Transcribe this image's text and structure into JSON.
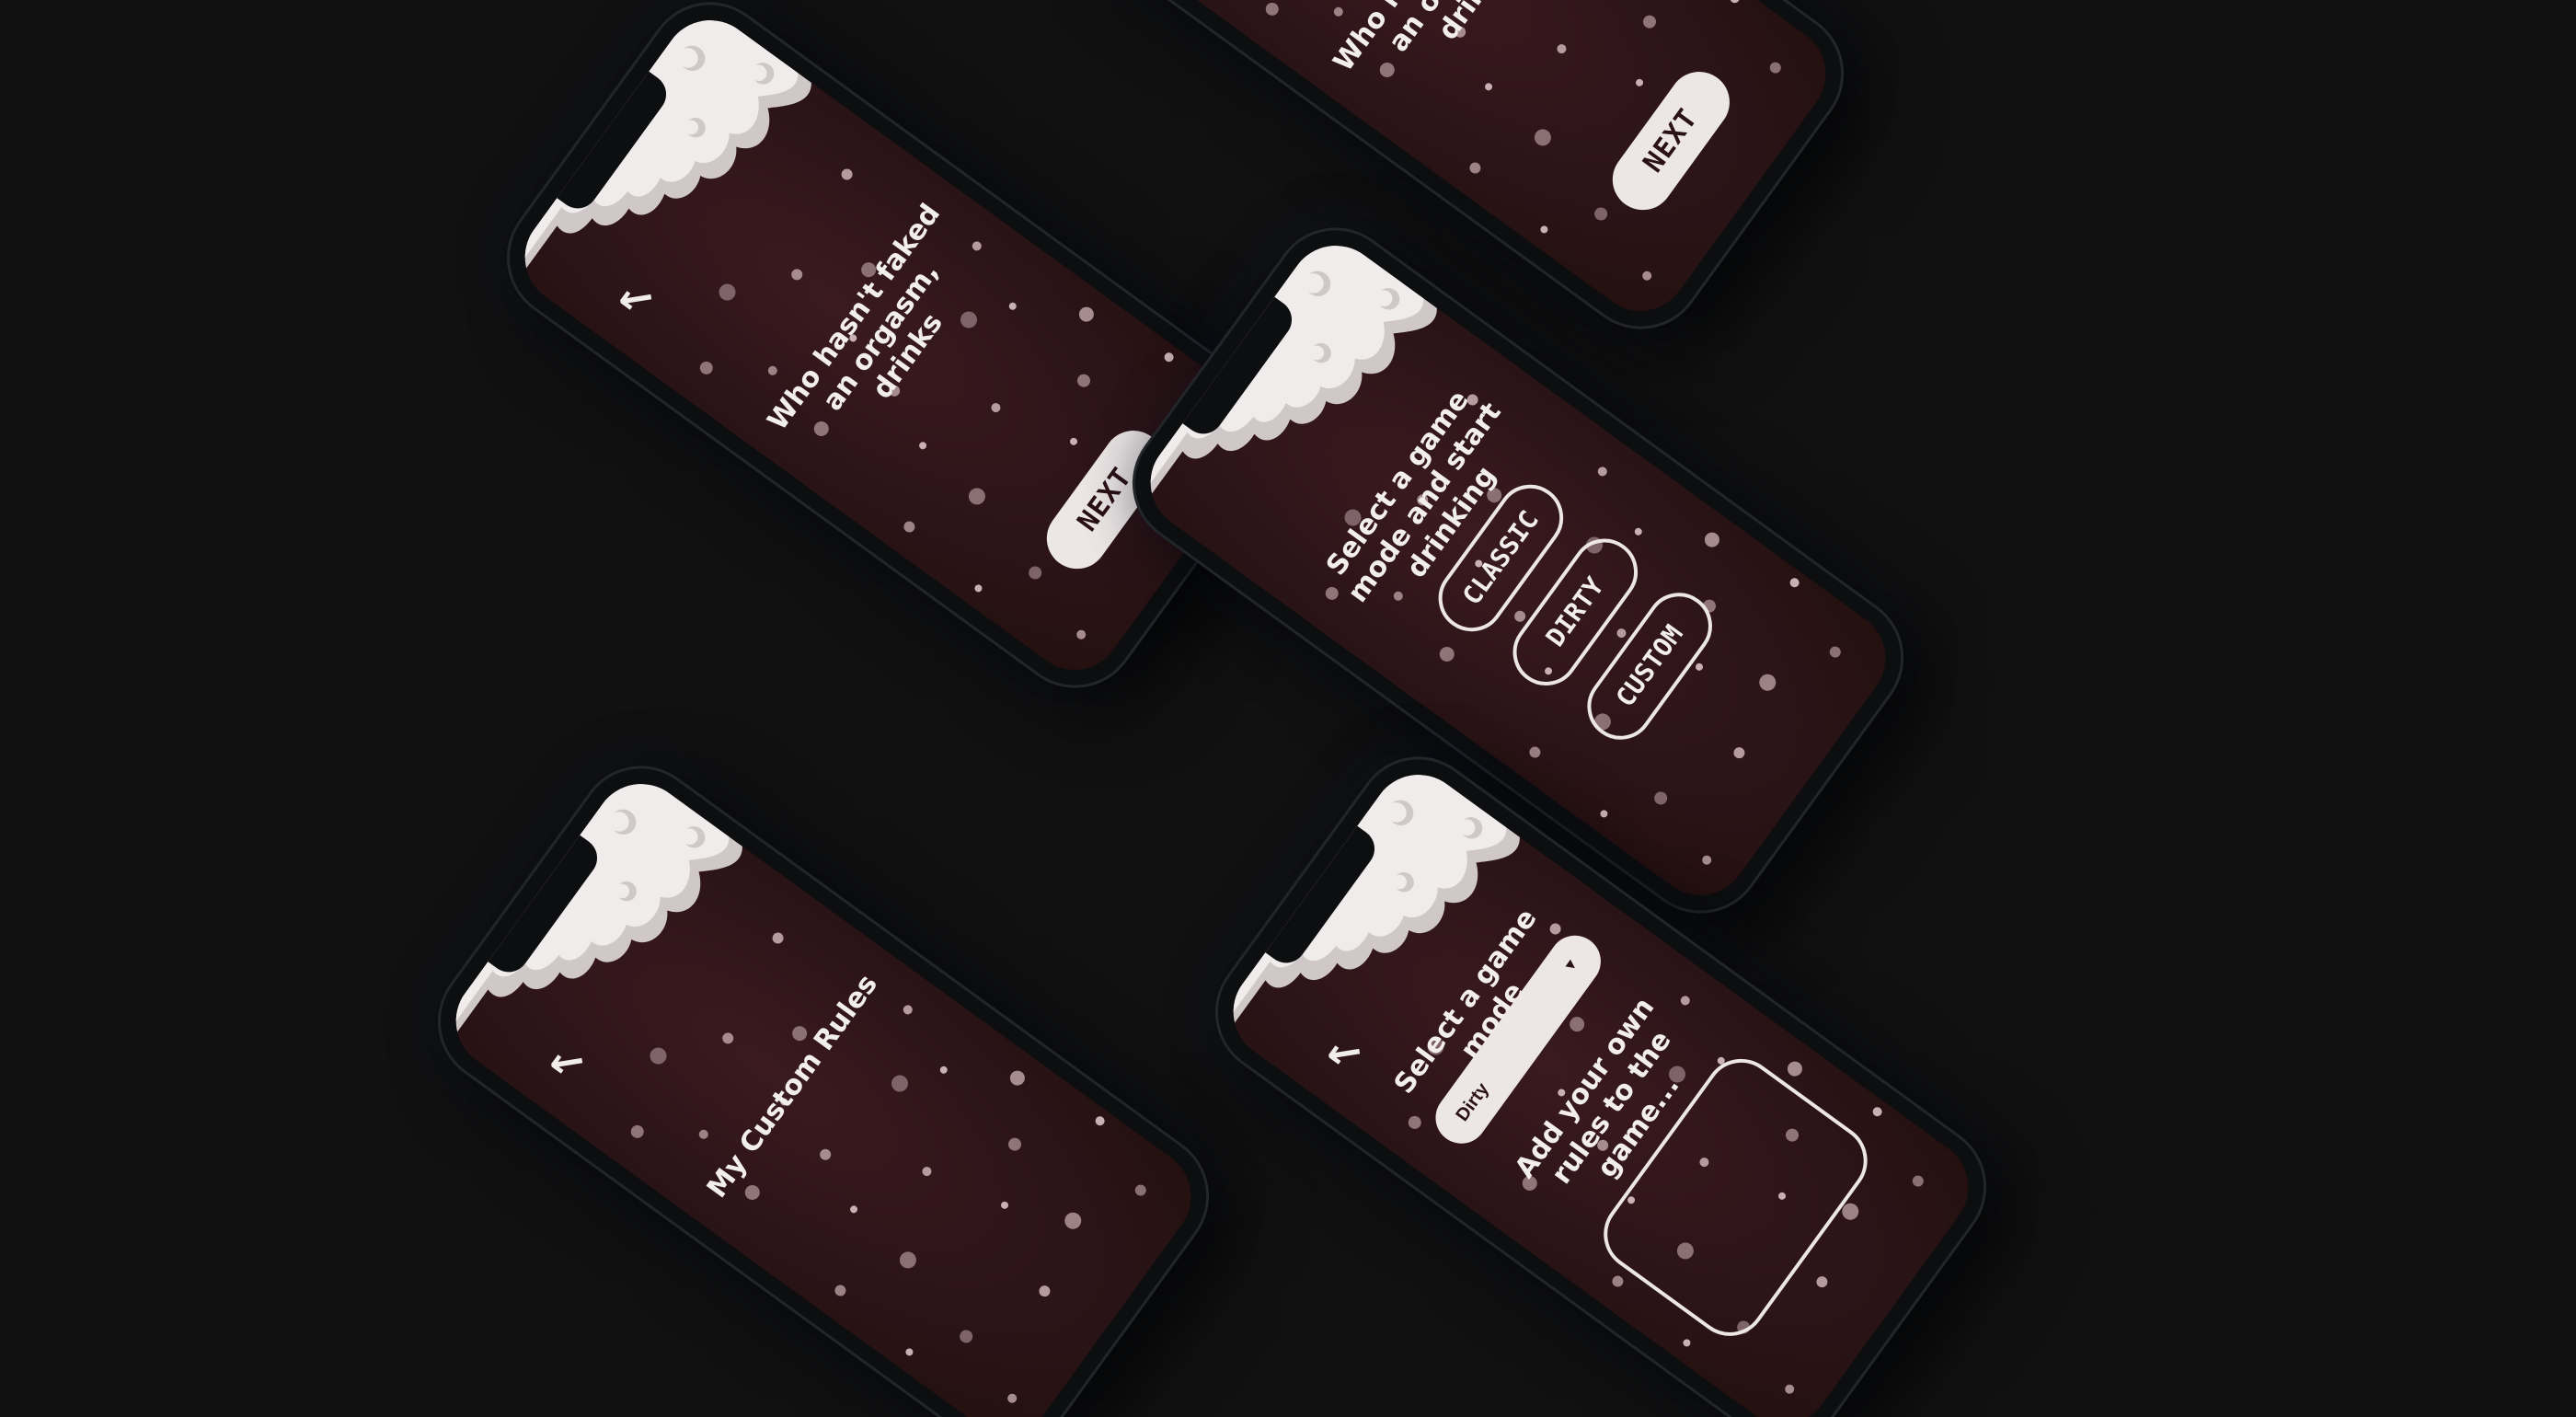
{
  "screens": {
    "question_top": {
      "title": "Who hasn't faked an orgasm, drinks",
      "next_label": "NEXT"
    },
    "question": {
      "back_icon": "arrow-up-left-icon",
      "title": "Who hasn't faked an orgasm, drinks",
      "next_label": "NEXT"
    },
    "mode_select": {
      "title": "Select a game mode and start drinking",
      "modes": [
        "CLASSIC",
        "DIRTY",
        "CUSTOM"
      ]
    },
    "custom_list": {
      "back_icon": "arrow-up-left-icon",
      "title": "My Custom Rules"
    },
    "custom_create": {
      "back_icon": "arrow-up-left-icon",
      "title": "Select a game mode",
      "selected_mode": "Dirty",
      "caret_icon": "triangle-down-icon",
      "add_rules_label": "Add your own rules to the game..."
    }
  },
  "colors": {
    "background": "#111112",
    "screen": "#2c1418",
    "snow": "#ece6e6",
    "button_text": "#2a1116"
  }
}
